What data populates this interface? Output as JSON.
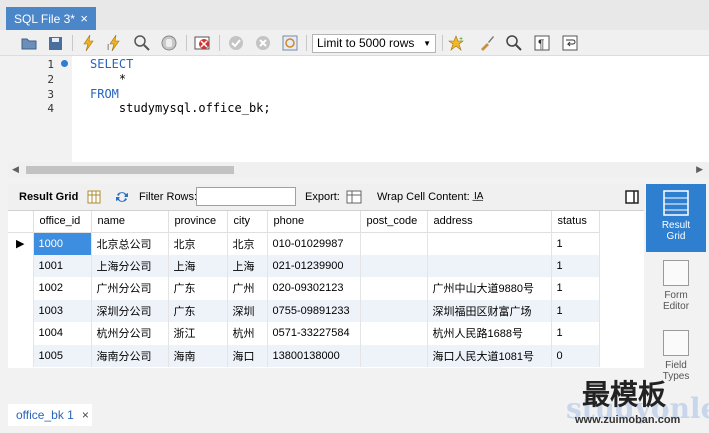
{
  "tab": {
    "title": "SQL File 3*",
    "close": "×"
  },
  "toolbar": {
    "limit_value": "Limit to 5000 rows"
  },
  "editor": {
    "line_numbers": [
      "1",
      "2",
      "3",
      "4"
    ],
    "lines": [
      "SELECT",
      "    *",
      "FROM",
      "    studymysql.office_bk;"
    ]
  },
  "result_toolbar": {
    "result_grid": "Result Grid",
    "filter_rows": "Filter Rows:",
    "filter_value": "",
    "export": "Export:",
    "wrap": "Wrap Cell Content:",
    "wrap_icon": "I̲A̲"
  },
  "grid": {
    "columns": [
      "office_id",
      "name",
      "province",
      "city",
      "phone",
      "post_code",
      "address",
      "status"
    ],
    "rows": [
      [
        "1000",
        "北京总公司",
        "北京",
        "北京",
        "010-01029987",
        "",
        "",
        "1"
      ],
      [
        "1001",
        "上海分公司",
        "上海",
        "上海",
        "021-01239900",
        "",
        "",
        "1"
      ],
      [
        "1002",
        "广州分公司",
        "广东",
        "广州",
        "020-09302123",
        "",
        "广州中山大道9880号",
        "1"
      ],
      [
        "1003",
        "深圳分公司",
        "广东",
        "深圳",
        "0755-09891233",
        "",
        "深圳福田区财富广场",
        "1"
      ],
      [
        "1004",
        "杭州分公司",
        "浙江",
        "杭州",
        "0571-33227584",
        "",
        "杭州人民路1688号",
        "1"
      ],
      [
        "1005",
        "海南分公司",
        "海南",
        "海口",
        "13800138000",
        "",
        "海口人民大道1081号",
        "0"
      ]
    ]
  },
  "right_panel": {
    "result_grid": [
      "Result",
      "Grid"
    ],
    "form_editor": [
      "Form",
      "Editor"
    ],
    "field_types": [
      "Field",
      "Types"
    ]
  },
  "bottom_tab": {
    "label": "office_bk 1",
    "close": "×"
  },
  "watermark": {
    "main": "最模板",
    "sub": "studyonlev",
    "url": "www.zuimoban.com"
  }
}
